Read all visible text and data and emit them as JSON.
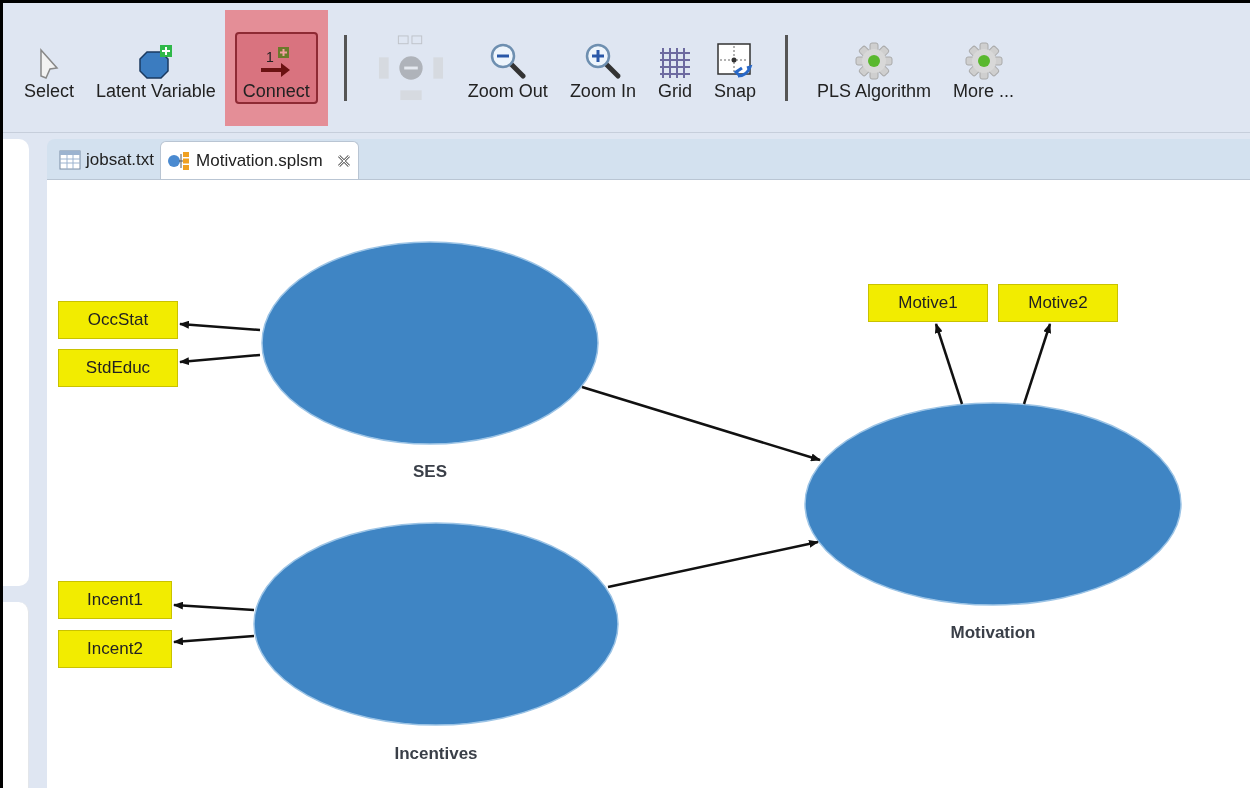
{
  "toolbar": [
    {
      "kind": "select",
      "label": "Select",
      "selected": false,
      "disabled": false
    },
    {
      "kind": "latent",
      "label": "Latent Variable",
      "selected": false,
      "disabled": false
    },
    {
      "kind": "connect",
      "label": "Connect",
      "icon_text": "1",
      "selected": true,
      "disabled": false
    },
    {
      "kind": "separator"
    },
    {
      "kind": "layout",
      "selected": false,
      "disabled": true
    },
    {
      "kind": "zoom-out",
      "label": "Zoom Out",
      "selected": false,
      "disabled": false
    },
    {
      "kind": "zoom-in",
      "label": "Zoom In",
      "selected": false,
      "disabled": false
    },
    {
      "kind": "grid",
      "label": "Grid",
      "selected": false,
      "disabled": false
    },
    {
      "kind": "snap",
      "label": "Snap",
      "selected": false,
      "disabled": false
    },
    {
      "kind": "separator"
    },
    {
      "kind": "gear",
      "label": "PLS Algorithm",
      "selected": false,
      "disabled": false
    },
    {
      "kind": "gear",
      "label": "More ...",
      "selected": false,
      "disabled": false
    }
  ],
  "tabs": [
    {
      "kind": "table",
      "label": "jobsat.txt",
      "selected": false,
      "closable": false
    },
    {
      "kind": "model",
      "label": "Motivation.splsm",
      "selected": true,
      "closable": true
    }
  ],
  "latent_variables": [
    {
      "name": "SES",
      "indicators": [
        "OccStat",
        "StdEduc"
      ]
    },
    {
      "name": "Incentives",
      "indicators": [
        "Incent1",
        "Incent2"
      ]
    },
    {
      "name": "Motivation",
      "indicators": [
        "Motive1",
        "Motive2"
      ]
    }
  ]
}
